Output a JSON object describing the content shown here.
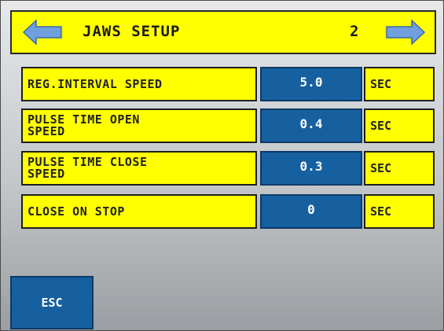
{
  "header": {
    "title": "JAWS SETUP",
    "page": "2",
    "prev_icon": "left-arrow-icon",
    "next_icon": "right-arrow-icon"
  },
  "rows": [
    {
      "label": "REG.INTERVAL SPEED",
      "value": "5.0",
      "unit": "SEC"
    },
    {
      "label": "PULSE TIME OPEN\nSPEED",
      "value": "0.4",
      "unit": "SEC"
    },
    {
      "label": "PULSE TIME CLOSE\nSPEED",
      "value": "0.3",
      "unit": "SEC"
    },
    {
      "label": "CLOSE ON STOP",
      "value": "0",
      "unit": "SEC"
    }
  ],
  "footer": {
    "esc_label": "ESC"
  },
  "colors": {
    "label_bg": "#ffff00",
    "value_bg": "#1760a0",
    "arrow": "#6f9fdc"
  }
}
